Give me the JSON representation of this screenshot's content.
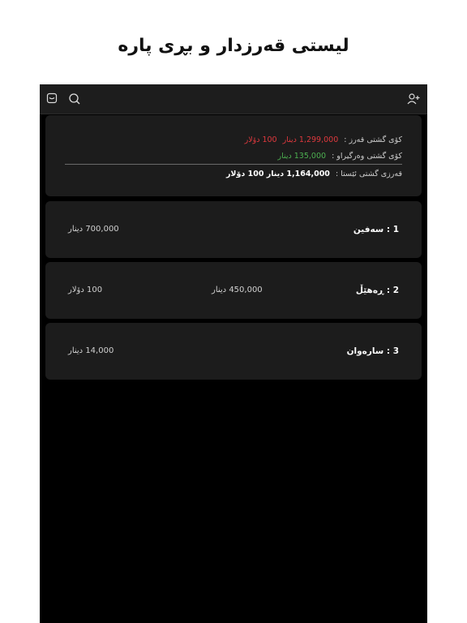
{
  "page_title": "لیستی قەرزدار و بڕی پارە",
  "toolbar": {
    "icons": [
      "add-user-icon",
      "search-icon",
      "inbox-icon"
    ]
  },
  "summary": {
    "total_debt_label": "کۆی گشتی قەرز :",
    "total_debt_dinar": "1,299,000  دینار",
    "total_debt_dollar": "100 دۆلار",
    "total_received_label": "کۆی گشتی وەرگیراو :",
    "total_received_dinar": "135,000 دینار",
    "current_debt_label": "قەرزی گشتی ئێستا :",
    "current_debt_value": "1,164,000 دینار 100 دۆلار"
  },
  "debtors": [
    {
      "name": "1 : سەفین",
      "dinar": "700,000 دینار",
      "dollar": ""
    },
    {
      "name": "2 : ڕەهێڵ",
      "dinar": "450,000 دینار",
      "dollar": "100 دۆلار"
    },
    {
      "name": "3 : سارەوان",
      "dinar": "14,000 دینار",
      "dollar": ""
    }
  ],
  "colors": {
    "debt": "#e0393e",
    "received": "#4caf50",
    "background": "#000000",
    "card": "#1c1c1c"
  }
}
